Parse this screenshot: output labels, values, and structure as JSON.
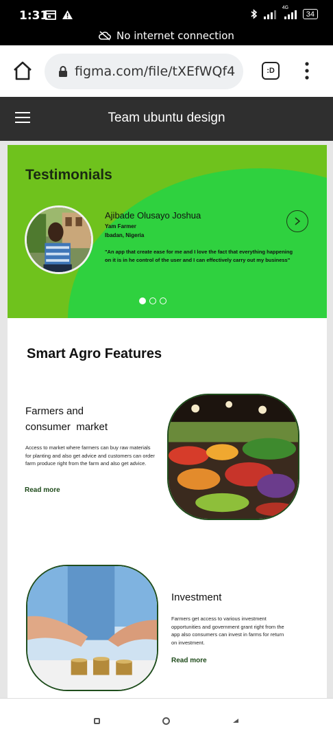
{
  "status": {
    "time": "1:31",
    "network_type": "4G",
    "battery": "34"
  },
  "banner": {
    "text": "No internet connection"
  },
  "browser": {
    "url": "figma.com/file/tXEfWQf4",
    "tabs_label": ":D"
  },
  "app": {
    "title": "Team ubuntu design"
  },
  "testimonial": {
    "heading": "Testimonials",
    "name": "Ajibade Olusayo Joshua",
    "role": "Yam Farmer",
    "location": "Ibadan, Nigeria",
    "quote": "\"An app that create ease for me and I love the fact that everything happening on it is in he control of the user and I can effectively carry out my business\""
  },
  "features": {
    "heading": "Smart Agro Features",
    "items": [
      {
        "title_line1": "Farmers and",
        "title_line2": "consumer  market",
        "description": "Access to market where farmers can buy raw materials  for planting and also get advice and customers can order farm produce right from the farm and also get advice.",
        "link": "Read more"
      },
      {
        "title": "Investment",
        "description": "Farmers get access to various investment opportunities and government grant right from the app also consumers can invest in farms for return on investment.",
        "link": "Read more"
      }
    ]
  },
  "colors": {
    "accent_green": "#2fd13f",
    "olive_green": "#6fc21d",
    "header_dark": "#2f2f2f"
  }
}
